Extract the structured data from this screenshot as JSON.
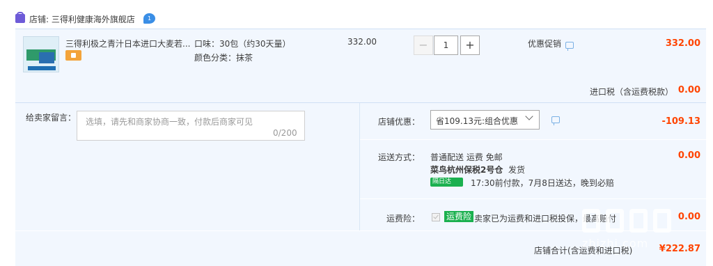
{
  "shop": {
    "label": "店铺: 三得利健康海外旗舰店",
    "chat_badge": "1"
  },
  "item": {
    "title": "三得利极之青汁日本进口大麦若...",
    "attr_flavor": "口味：30包（约30天量）",
    "attr_color": "颜色分类：抹茶",
    "price": "332.00",
    "quantity": "1",
    "minus": "−",
    "plus": "+",
    "promo_label": "优惠促销",
    "total": "332.00"
  },
  "tax": {
    "label": "进口税（含运费税款）",
    "value": "0.00"
  },
  "message": {
    "label": "给卖家留言：",
    "placeholder": "选填，请先和商家协商一致，付款后商家可见",
    "counter": "0/200"
  },
  "discount": {
    "label": "店铺优惠：",
    "selected": "省109.13元:组合优惠",
    "value": "-109.13"
  },
  "shipping": {
    "label": "运送方式：",
    "line1": "普通配送 运费 免邮",
    "warehouse": "菜鸟杭州保税2号仓",
    "dispatch": "发货",
    "badge": "隔日达",
    "promise": "17:30前付款，7月8日送达，晚到必赔",
    "value": "0.00"
  },
  "insurance": {
    "label": "运费险：",
    "tag": "运费险",
    "desc": "卖家已为运费和进口税投保，最高赔付",
    "value": "0.00"
  },
  "total": {
    "label": "店铺合计(含运费和进口税)",
    "value": "¥222.87"
  },
  "watermark": {
    "text": "zhizhi.com"
  },
  "colors": {
    "accent_red": "#ff4400",
    "panel_bg": "#f2f7fe",
    "green_badge": "#1bb04f"
  }
}
